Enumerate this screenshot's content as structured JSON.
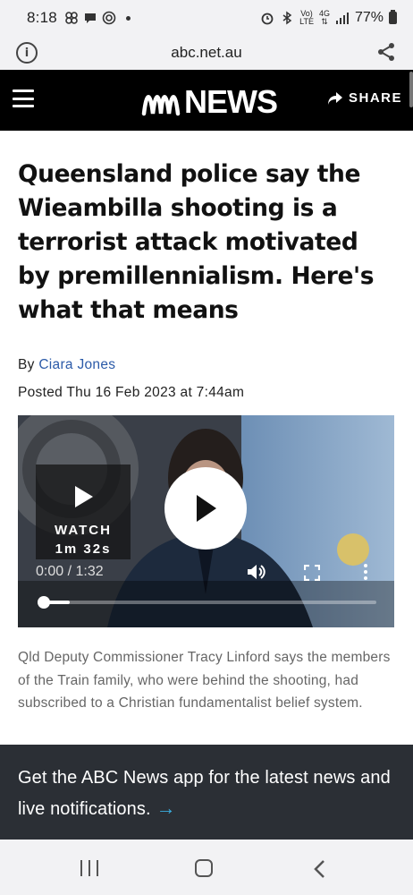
{
  "status_bar": {
    "time": "8:18",
    "network_label_top": "Vo)",
    "network_label_bottom": "LTE",
    "signal_type": "4G",
    "battery": "77%"
  },
  "browser": {
    "url": "abc.net.au"
  },
  "header": {
    "logo_text": "NEWS",
    "share_label": "SHARE"
  },
  "article": {
    "headline": "Queensland police say the Wieambilla shooting is a terrorist attack motivated by premillennialism. Here's what that means",
    "byline_prefix": "By",
    "author": "Ciara Jones",
    "posted": "Posted Thu 16 Feb 2023 at 7:44am",
    "caption": "Qld Deputy Commissioner Tracy Linford says the members of the Train family, who were behind the shooting, had subscribed to a Christian fundamentalist belief system."
  },
  "video": {
    "watch_label": "WATCH",
    "duration_label": "1m 32s",
    "timecode": "0:00 / 1:32",
    "progress": 0.08
  },
  "banner": {
    "text": "Get the ABC News app for the latest news and live notifications.",
    "arrow": "→"
  },
  "colors": {
    "header_bg": "#000000",
    "author_link": "#2b5aa8",
    "banner_bg": "#2b2f35",
    "banner_arrow": "#3aaee0"
  }
}
